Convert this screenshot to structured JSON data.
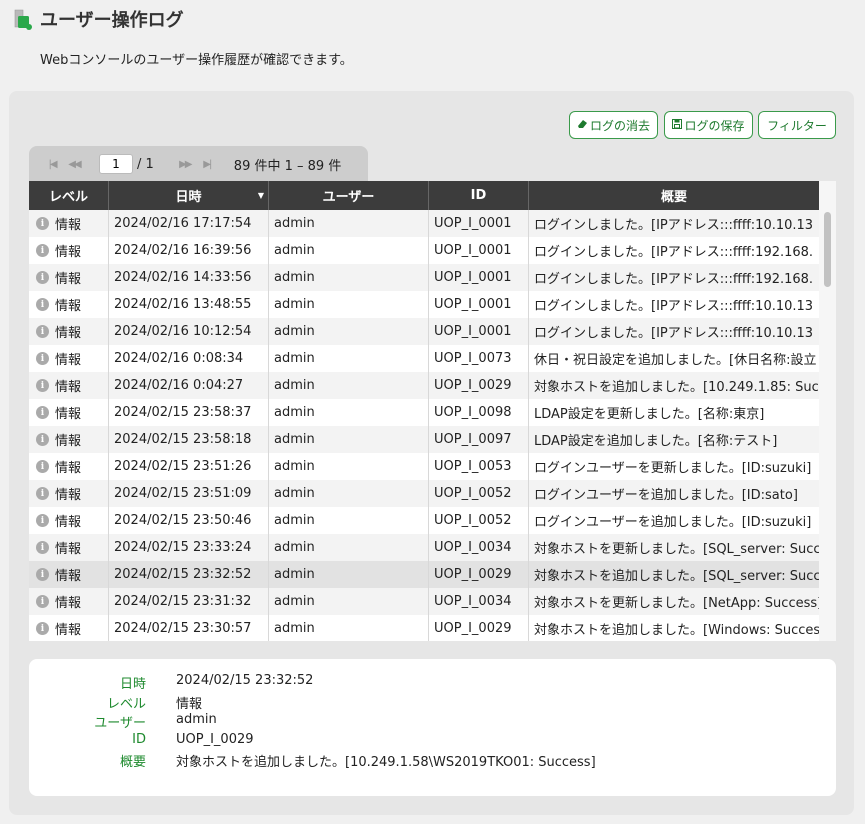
{
  "page": {
    "title": "ユーザー操作ログ",
    "description": "Webコンソールのユーザー操作履歴が確認できます。"
  },
  "toolbar": {
    "clear_label": "ログの消去",
    "save_label": "ログの保存",
    "filter_label": "フィルター"
  },
  "pager": {
    "first": "|◀",
    "prev": "◀◀",
    "next": "▶▶",
    "last": "▶|",
    "current_page": "1",
    "page_total": "/ 1",
    "summary": "89 件中 1 – 89 件"
  },
  "table": {
    "columns": [
      "レベル",
      "日時",
      "ユーザー",
      "ID",
      "概要"
    ],
    "rows": [
      {
        "level": "情報",
        "date": "2024/02/16 17:17:54",
        "user": "admin",
        "id": "UOP_I_0001",
        "summary": "ログインしました。[IPアドレス:::ffff:10.10.13"
      },
      {
        "level": "情報",
        "date": "2024/02/16 16:39:56",
        "user": "admin",
        "id": "UOP_I_0001",
        "summary": "ログインしました。[IPアドレス:::ffff:192.168."
      },
      {
        "level": "情報",
        "date": "2024/02/16 14:33:56",
        "user": "admin",
        "id": "UOP_I_0001",
        "summary": "ログインしました。[IPアドレス:::ffff:192.168."
      },
      {
        "level": "情報",
        "date": "2024/02/16 13:48:55",
        "user": "admin",
        "id": "UOP_I_0001",
        "summary": "ログインしました。[IPアドレス:::ffff:10.10.13"
      },
      {
        "level": "情報",
        "date": "2024/02/16 10:12:54",
        "user": "admin",
        "id": "UOP_I_0001",
        "summary": "ログインしました。[IPアドレス:::ffff:10.10.13"
      },
      {
        "level": "情報",
        "date": "2024/02/16 0:08:34",
        "user": "admin",
        "id": "UOP_I_0073",
        "summary": "休日・祝日設定を追加しました。[休日名称:設立"
      },
      {
        "level": "情報",
        "date": "2024/02/16 0:04:27",
        "user": "admin",
        "id": "UOP_I_0029",
        "summary": "対象ホストを追加しました。[10.249.1.85: Succ"
      },
      {
        "level": "情報",
        "date": "2024/02/15 23:58:37",
        "user": "admin",
        "id": "UOP_I_0098",
        "summary": "LDAP設定を更新しました。[名称:東京]"
      },
      {
        "level": "情報",
        "date": "2024/02/15 23:58:18",
        "user": "admin",
        "id": "UOP_I_0097",
        "summary": "LDAP設定を追加しました。[名称:テスト]"
      },
      {
        "level": "情報",
        "date": "2024/02/15 23:51:26",
        "user": "admin",
        "id": "UOP_I_0053",
        "summary": "ログインユーザーを更新しました。[ID:suzuki]"
      },
      {
        "level": "情報",
        "date": "2024/02/15 23:51:09",
        "user": "admin",
        "id": "UOP_I_0052",
        "summary": "ログインユーザーを追加しました。[ID:sato]"
      },
      {
        "level": "情報",
        "date": "2024/02/15 23:50:46",
        "user": "admin",
        "id": "UOP_I_0052",
        "summary": "ログインユーザーを追加しました。[ID:suzuki]"
      },
      {
        "level": "情報",
        "date": "2024/02/15 23:33:24",
        "user": "admin",
        "id": "UOP_I_0034",
        "summary": "対象ホストを更新しました。[SQL_server: Succ"
      },
      {
        "level": "情報",
        "date": "2024/02/15 23:32:52",
        "user": "admin",
        "id": "UOP_I_0029",
        "summary": "対象ホストを追加しました。[SQL_server: Succ"
      },
      {
        "level": "情報",
        "date": "2024/02/15 23:31:32",
        "user": "admin",
        "id": "UOP_I_0034",
        "summary": "対象ホストを更新しました。[NetApp: Success]"
      },
      {
        "level": "情報",
        "date": "2024/02/15 23:30:57",
        "user": "admin",
        "id": "UOP_I_0029",
        "summary": "対象ホストを追加しました。[Windows: Success"
      }
    ],
    "selected_row": 13
  },
  "detail": {
    "date_label": "日時",
    "date": "2024/02/15 23:32:52",
    "level_label": "レベル",
    "level": "情報",
    "user_label": "ユーザー",
    "user": "admin",
    "id_label": "ID",
    "id": "UOP_I_0029",
    "summary_label": "概要",
    "summary": "対象ホストを追加しました。[10.249.1.58\\WS2019TKO01: Success]"
  },
  "colors": {
    "accent": "#1e7a2e",
    "header_bg": "#3c3c3c",
    "logo_green": "#2aa84a"
  }
}
